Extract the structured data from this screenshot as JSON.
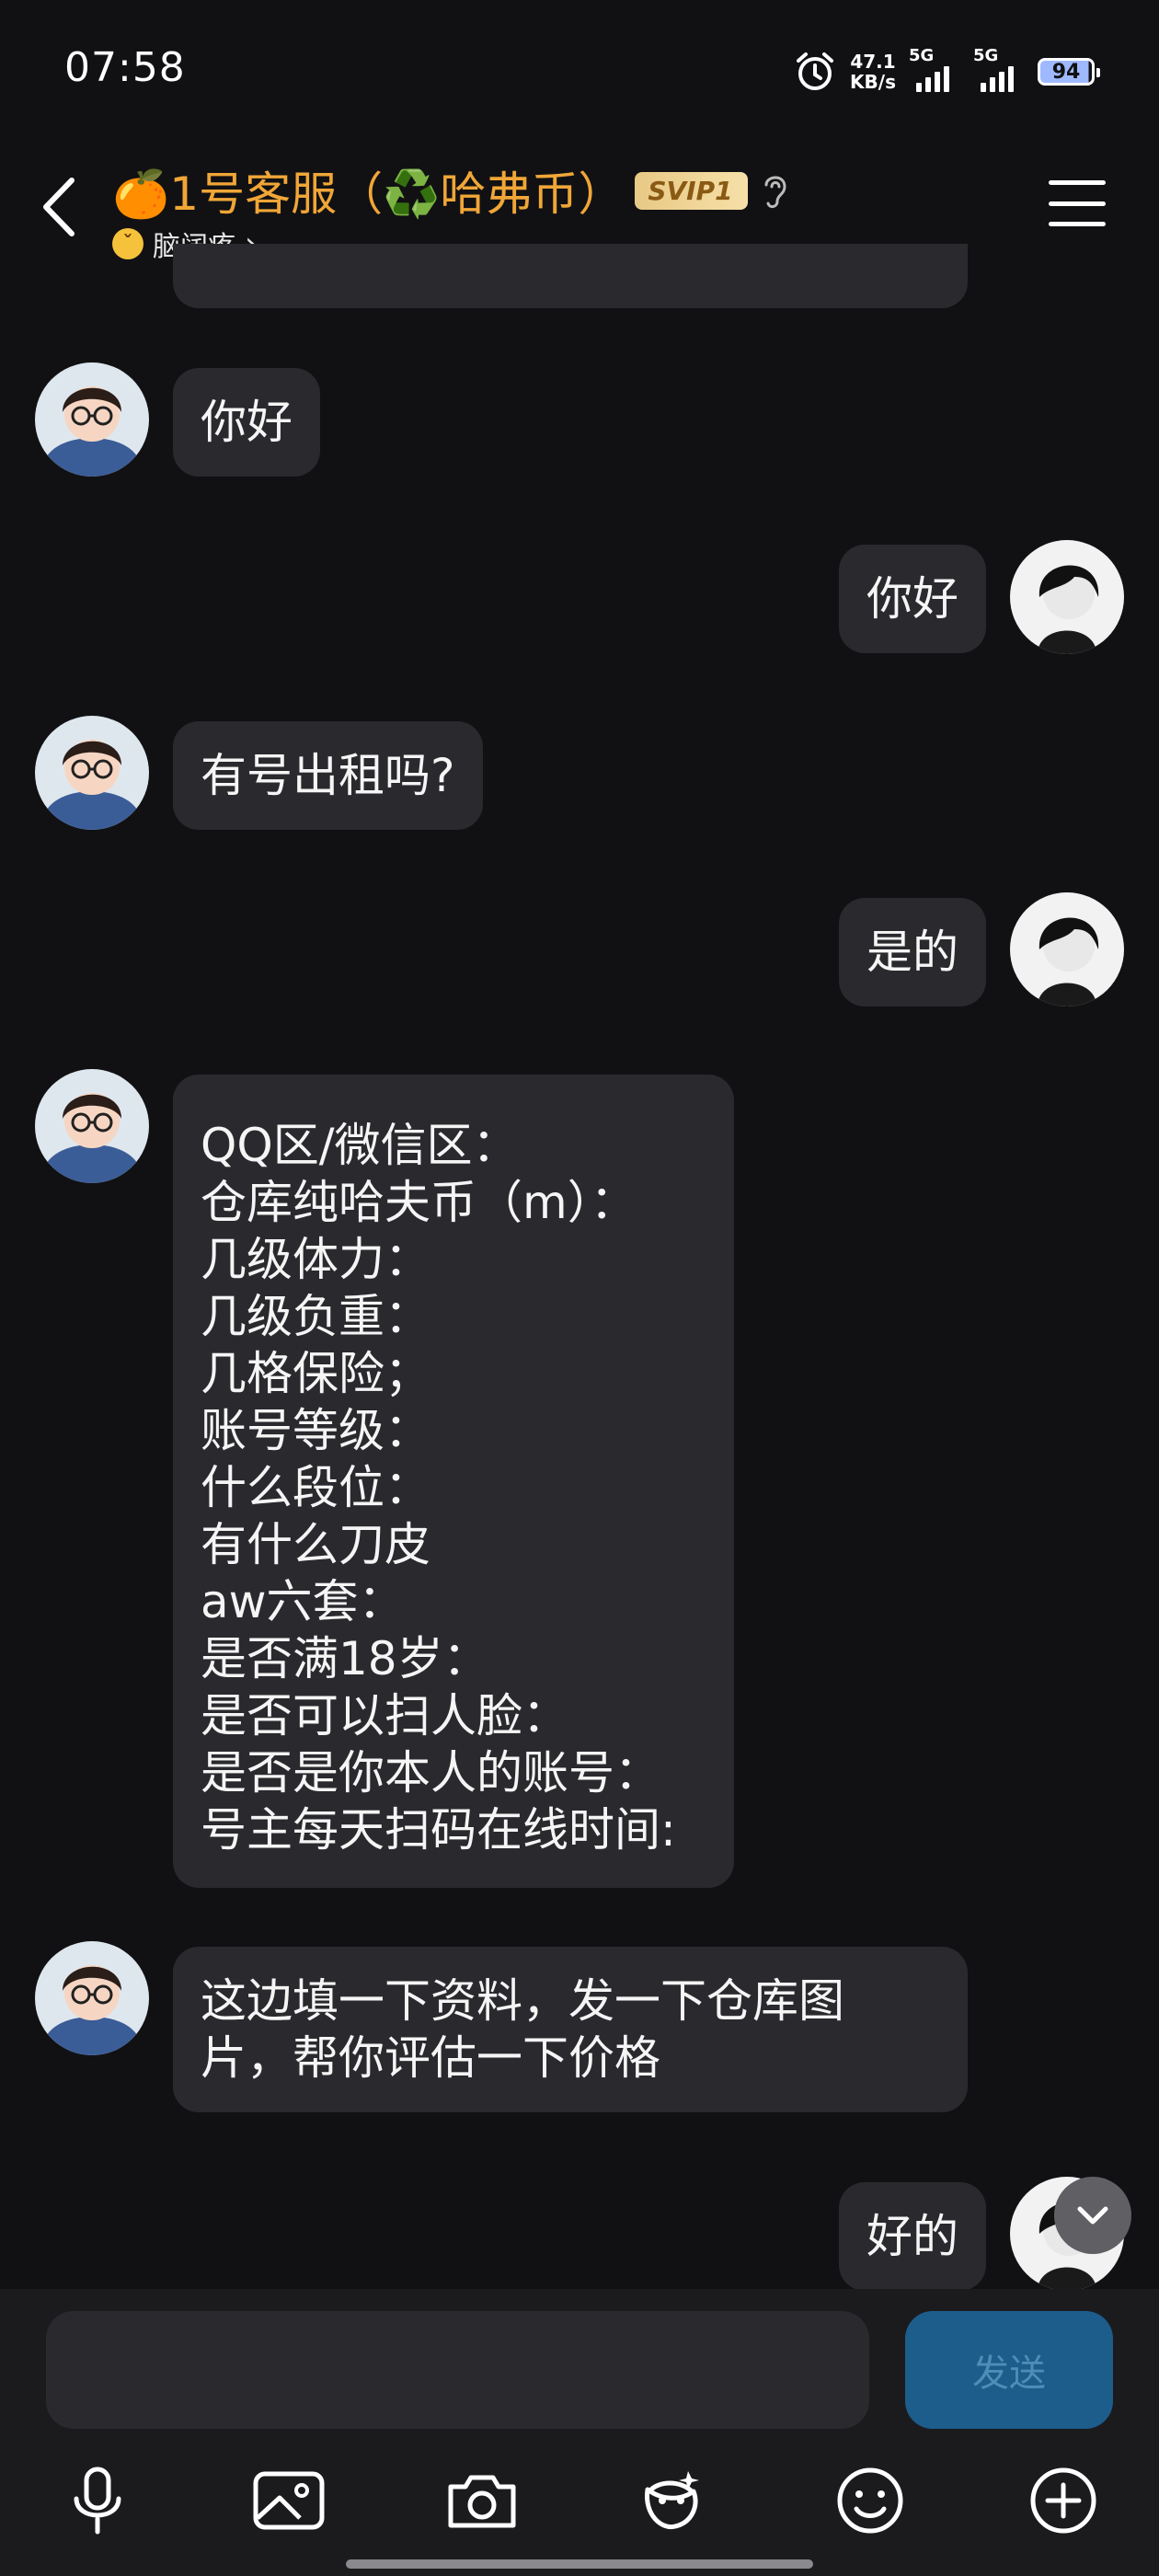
{
  "status_bar": {
    "time": "07:58",
    "speed_value": "47.1",
    "speed_unit": "KB/s",
    "net1": "5G",
    "net2": "5G",
    "battery": "94"
  },
  "header": {
    "title": "🍊1号客服（♻️哈弗币）",
    "badge": "SVIP1",
    "subtitle": "脑阔疼",
    "subtitle_chevron": "›"
  },
  "messages": [
    {
      "side": "left",
      "text": "你好"
    },
    {
      "side": "right",
      "text": "你好"
    },
    {
      "side": "left",
      "text": "有号出租吗?"
    },
    {
      "side": "right",
      "text": "是的"
    },
    {
      "side": "left",
      "text": "QQ区/微信区：\n仓库纯哈夫币（m）：\n几级体力：\n几级负重：\n几格保险；\n账号等级：\n什么段位：\n有什么刀皮\naw六套：\n是否满18岁：\n是否可以扫人脸：\n是否是你本人的账号：\n号主每天扫码在线时间:"
    },
    {
      "side": "left",
      "text": "这边填一下资料，发一下仓库图\n片，帮你评估一下价格"
    },
    {
      "side": "right",
      "text": "好的"
    }
  ],
  "input": {
    "placeholder": "",
    "send_label": "发送"
  },
  "toolbar": {
    "icons": [
      "microphone-icon",
      "image-icon",
      "camera-icon",
      "red-packet-icon",
      "emoji-icon",
      "plus-icon"
    ]
  },
  "colors": {
    "background": "#111114",
    "bubble": "#2a2a2e",
    "title": "#f0a637",
    "send_button": "#1c5d8c"
  }
}
